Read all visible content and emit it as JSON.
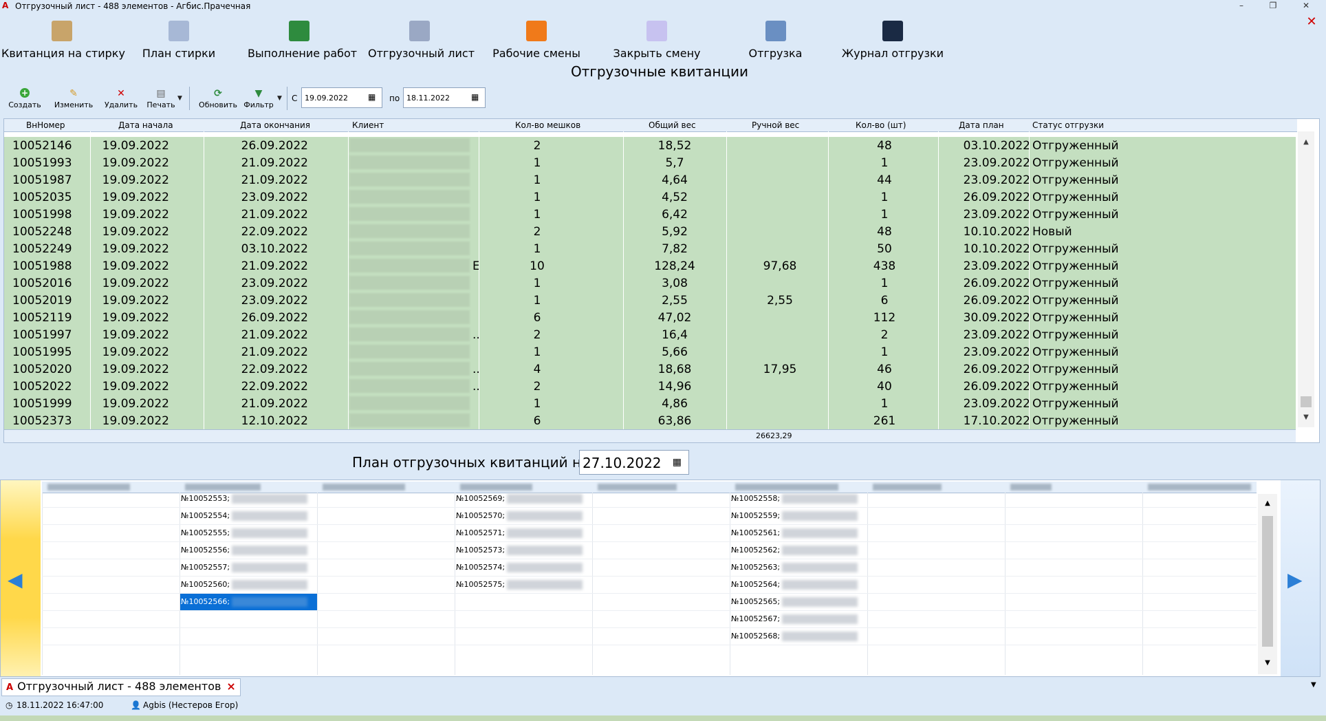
{
  "window": {
    "title": "Отгрузочный лист - 488 элементов - Агбис.Прачечная",
    "minimize": "–",
    "maximize": "❐",
    "close": "✕",
    "app_close": "✕"
  },
  "ribbon": [
    {
      "label": "Квитанция на стирку",
      "icon": "receipt-icon",
      "color": "#c8a46a"
    },
    {
      "label": "План стирки",
      "icon": "laundry-plan-icon",
      "color": "#a7b8d6"
    },
    {
      "label": "Выполнение работ",
      "icon": "book-icon",
      "color": "#2e8b3e"
    },
    {
      "label": "Отгрузочный лист",
      "icon": "clipboard-icon",
      "color": "#9aa8c4"
    },
    {
      "label": "Рабочие смены",
      "icon": "traffic-cone-icon",
      "color": "#f07a1a"
    },
    {
      "label": "Закрыть смену",
      "icon": "lightbulb-icon",
      "color": "#c7c2f0"
    },
    {
      "label": "Отгрузка",
      "icon": "truck-icon",
      "color": "#6a8fc2"
    },
    {
      "label": "Журнал отгрузки",
      "icon": "journal-icon",
      "color": "#1a2a44"
    }
  ],
  "heading": "Отгрузочные квитанции",
  "toolbar": {
    "create": "Создать",
    "edit": "Изменить",
    "delete": "Удалить",
    "print": "Печать",
    "refresh": "Обновить",
    "filter": "Фильтр",
    "from_label": "С",
    "from_date": "19.09.2022",
    "to_label": "по",
    "to_date": "18.11.2022"
  },
  "grid": {
    "columns": [
      "ВнНомер",
      "Дата начала",
      "Дата окончания",
      "Клиент",
      "Кол-во мешков",
      "Общий вес",
      "Ручной вес",
      "Кол-во (шт)",
      "Дата план",
      "Статус отгрузки"
    ],
    "rows": [
      {
        "id": "10052146",
        "start": "19.09.2022",
        "end": "26.09.2022",
        "bags": "2",
        "weight": "18,52",
        "manual": "",
        "qty": "48",
        "plan": "03.10.2022",
        "status": "Отгруженный"
      },
      {
        "id": "10051993",
        "start": "19.09.2022",
        "end": "21.09.2022",
        "bags": "1",
        "weight": "5,7",
        "manual": "",
        "qty": "1",
        "plan": "23.09.2022",
        "status": "Отгруженный"
      },
      {
        "id": "10051987",
        "start": "19.09.2022",
        "end": "21.09.2022",
        "bags": "1",
        "weight": "4,64",
        "manual": "",
        "qty": "44",
        "plan": "23.09.2022",
        "status": "Отгруженный"
      },
      {
        "id": "10052035",
        "start": "19.09.2022",
        "end": "23.09.2022",
        "bags": "1",
        "weight": "4,52",
        "manual": "",
        "qty": "1",
        "plan": "26.09.2022",
        "status": "Отгруженный"
      },
      {
        "id": "10051998",
        "start": "19.09.2022",
        "end": "21.09.2022",
        "bags": "1",
        "weight": "6,42",
        "manual": "",
        "qty": "1",
        "plan": "23.09.2022",
        "status": "Отгруженный"
      },
      {
        "id": "10052248",
        "start": "19.09.2022",
        "end": "22.09.2022",
        "bags": "2",
        "weight": "5,92",
        "manual": "",
        "qty": "48",
        "plan": "10.10.2022",
        "status": "Новый"
      },
      {
        "id": "10052249",
        "start": "19.09.2022",
        "end": "03.10.2022",
        "bags": "1",
        "weight": "7,82",
        "manual": "",
        "qty": "50",
        "plan": "10.10.2022",
        "status": "Отгруженный"
      },
      {
        "id": "10051988",
        "start": "19.09.2022",
        "end": "21.09.2022",
        "bags": "10",
        "weight": "128,24",
        "manual": "97,68",
        "qty": "438",
        "plan": "23.09.2022",
        "status": "Отгруженный",
        "client_suffix": "E"
      },
      {
        "id": "10052016",
        "start": "19.09.2022",
        "end": "23.09.2022",
        "bags": "1",
        "weight": "3,08",
        "manual": "",
        "qty": "1",
        "plan": "26.09.2022",
        "status": "Отгруженный"
      },
      {
        "id": "10052019",
        "start": "19.09.2022",
        "end": "23.09.2022",
        "bags": "1",
        "weight": "2,55",
        "manual": "2,55",
        "qty": "6",
        "plan": "26.09.2022",
        "status": "Отгруженный"
      },
      {
        "id": "10052119",
        "start": "19.09.2022",
        "end": "26.09.2022",
        "bags": "6",
        "weight": "47,02",
        "manual": "",
        "qty": "112",
        "plan": "30.09.2022",
        "status": "Отгруженный"
      },
      {
        "id": "10051997",
        "start": "19.09.2022",
        "end": "21.09.2022",
        "bags": "2",
        "weight": "16,4",
        "manual": "",
        "qty": "2",
        "plan": "23.09.2022",
        "status": "Отгруженный",
        "client_suffix": ".."
      },
      {
        "id": "10051995",
        "start": "19.09.2022",
        "end": "21.09.2022",
        "bags": "1",
        "weight": "5,66",
        "manual": "",
        "qty": "1",
        "plan": "23.09.2022",
        "status": "Отгруженный"
      },
      {
        "id": "10052020",
        "start": "19.09.2022",
        "end": "22.09.2022",
        "bags": "4",
        "weight": "18,68",
        "manual": "17,95",
        "qty": "46",
        "plan": "26.09.2022",
        "status": "Отгруженный",
        "client_suffix": ".."
      },
      {
        "id": "10052022",
        "start": "19.09.2022",
        "end": "22.09.2022",
        "bags": "2",
        "weight": "14,96",
        "manual": "",
        "qty": "40",
        "plan": "26.09.2022",
        "status": "Отгруженный",
        "client_suffix": ".."
      },
      {
        "id": "10051999",
        "start": "19.09.2022",
        "end": "21.09.2022",
        "bags": "1",
        "weight": "4,86",
        "manual": "",
        "qty": "1",
        "plan": "23.09.2022",
        "status": "Отгруженный"
      },
      {
        "id": "10052373",
        "start": "19.09.2022",
        "end": "12.10.2022",
        "bags": "6",
        "weight": "63,86",
        "manual": "",
        "qty": "261",
        "plan": "17.10.2022",
        "status": "Отгруженный"
      }
    ],
    "total_weight": "26623,29"
  },
  "plan": {
    "label": "План отгрузочных квитанций на",
    "date": "27.10.2022"
  },
  "lower_grid": {
    "columns": [
      [
        {
          "text": "№10052553;"
        },
        {
          "text": "№10052554;"
        },
        {
          "text": "№10052555;"
        },
        {
          "text": "№10052556;"
        },
        {
          "text": "№10052557;"
        },
        {
          "text": "№10052560;"
        },
        {
          "text": "№10052566;",
          "selected": true
        }
      ],
      [],
      [
        {
          "text": "№10052569;"
        },
        {
          "text": "№10052570;"
        },
        {
          "text": "№10052571;"
        },
        {
          "text": "№10052573;"
        },
        {
          "text": "№10052574;"
        },
        {
          "text": "№10052575;"
        }
      ],
      [],
      [
        {
          "text": "№10052558;"
        },
        {
          "text": "№10052559;"
        },
        {
          "text": "№10052561;"
        },
        {
          "text": "№10052562;"
        },
        {
          "text": "№10052563;"
        },
        {
          "text": "№10052564;"
        },
        {
          "text": "№10052565;"
        },
        {
          "text": "№10052567;"
        },
        {
          "text": "№10052568;"
        }
      ]
    ]
  },
  "tab": {
    "label": "Отгрузочный лист - 488 элементов",
    "close": "×"
  },
  "status": {
    "datetime": "18.11.2022 16:47:00",
    "user": "Agbis (Нестеров Егор)"
  },
  "colors": {
    "row_green": "#c4dfc0",
    "selection": "#0a6fd6",
    "chrome": "#dce9f7"
  }
}
